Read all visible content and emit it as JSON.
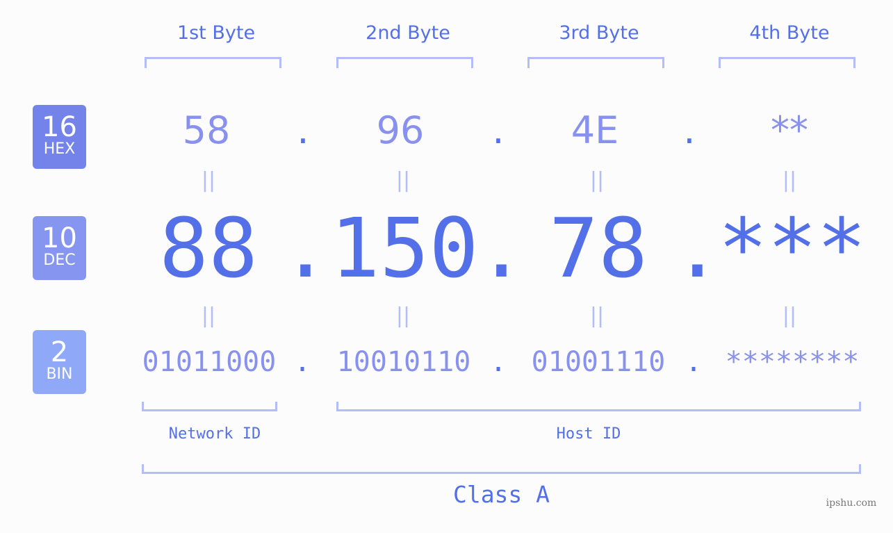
{
  "colors": {
    "primary": "#5470e8",
    "digit_light": "#8892ee",
    "bracket": "#b3bdf7",
    "badge_hex": "#7383ea",
    "badge_dec": "#8595f0",
    "badge_bin": "#8fa8f8",
    "background": "#fbfcfb"
  },
  "byte_labels": [
    "1st Byte",
    "2nd Byte",
    "3rd Byte",
    "4th Byte"
  ],
  "badges": {
    "hex": {
      "number": "16",
      "label": "HEX"
    },
    "dec": {
      "number": "10",
      "label": "DEC"
    },
    "bin": {
      "number": "2",
      "label": "BIN"
    }
  },
  "hex": [
    "58",
    "96",
    "4E",
    "**"
  ],
  "dec": [
    "88",
    "150",
    "78",
    "***"
  ],
  "bin": [
    "01011000",
    "10010110",
    "01001110",
    "********"
  ],
  "separator": ".",
  "equals": "=",
  "network_id_label": "Network ID",
  "host_id_label": "Host ID",
  "class_label": "Class A",
  "watermark": "ipshu.com"
}
